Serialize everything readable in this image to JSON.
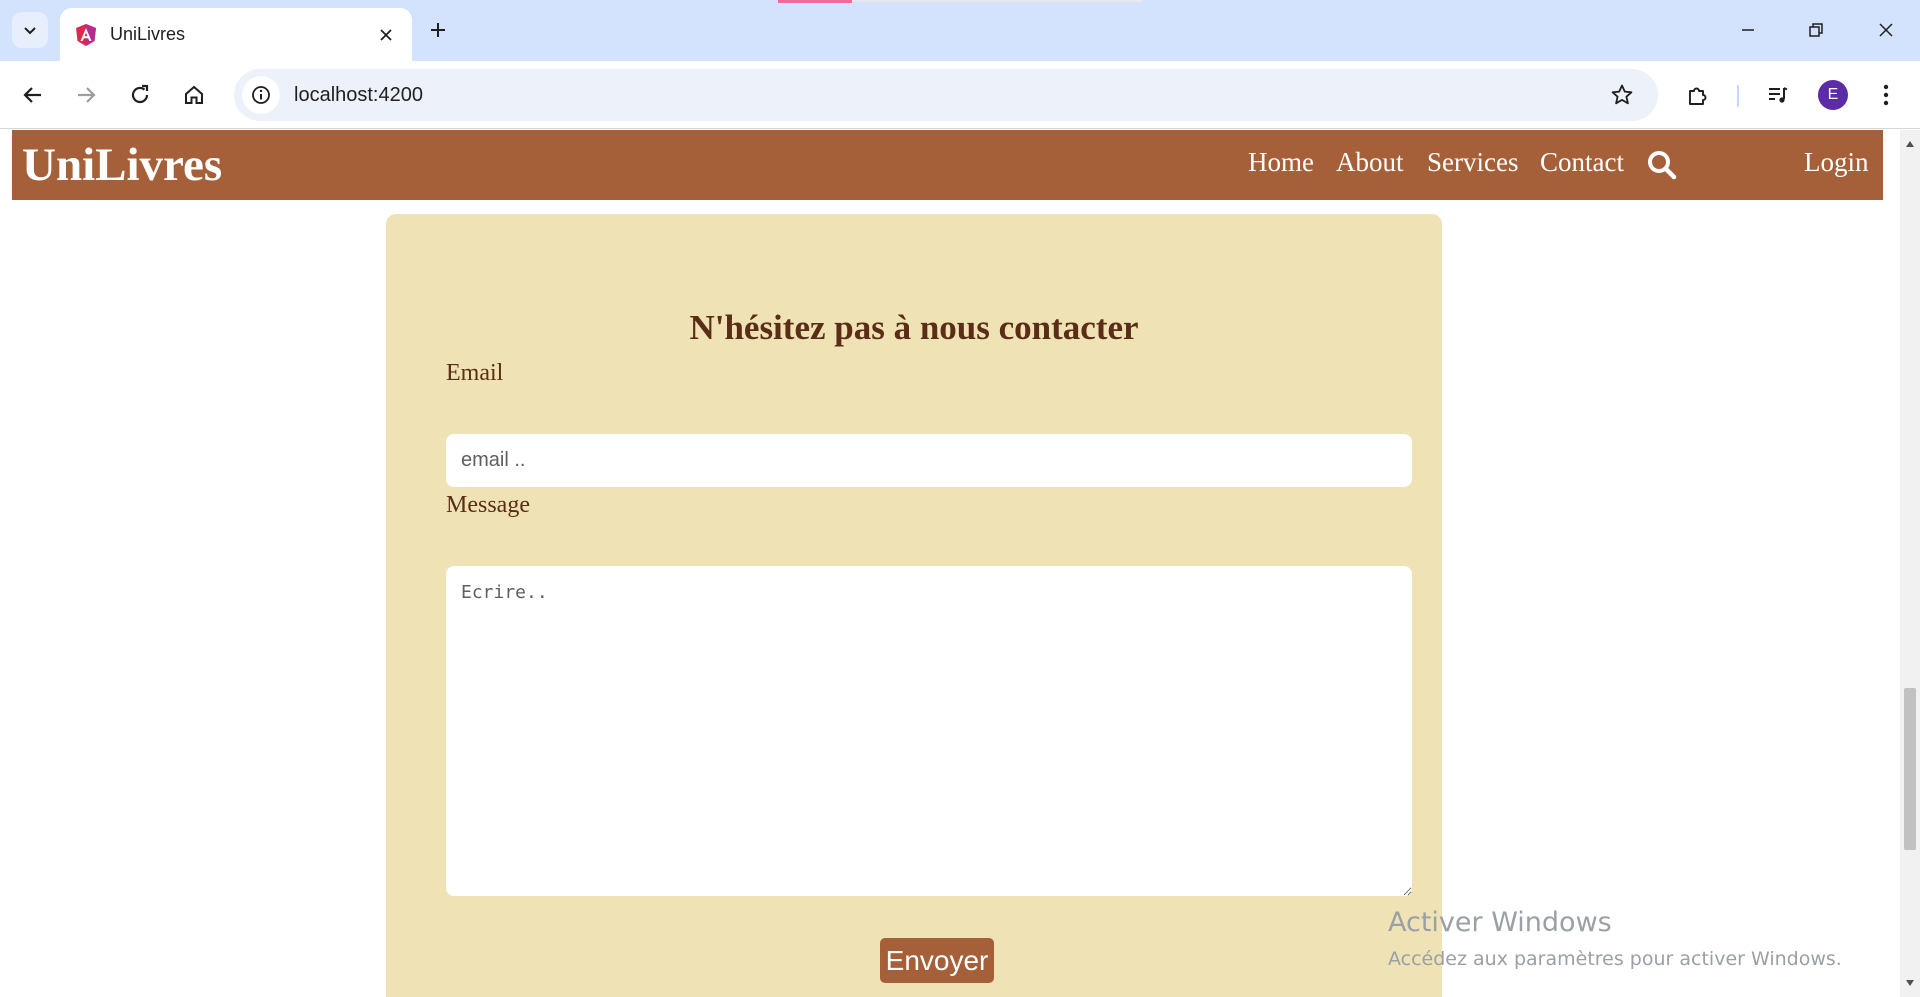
{
  "browser": {
    "tab_title": "UniLivres",
    "url": "localhost:4200",
    "profile_initial": "E",
    "icons": [
      "tab-list-icon",
      "angular-favicon",
      "close-icon",
      "plus-icon",
      "minimize-icon",
      "restore-icon",
      "close-window-icon",
      "back-icon",
      "forward-icon",
      "reload-icon",
      "home-icon",
      "site-info-icon",
      "star-icon",
      "extensions-icon",
      "media-control-icon",
      "more-icon"
    ]
  },
  "navbar": {
    "brand": "UniLivres",
    "links": [
      "Home",
      "About",
      "Services",
      "Contact"
    ],
    "login": "Login",
    "color": "#a5603a"
  },
  "form": {
    "title": "N'hésitez pas à nous contacter",
    "email_label": "Email",
    "email_placeholder": "email ..",
    "message_label": "Message",
    "message_placeholder": "Ecrire..",
    "submit": "Envoyer",
    "card_color": "#efe3b6",
    "text_color": "#5a2d16"
  },
  "watermark": {
    "title": "Activer Windows",
    "subtitle": "Accédez aux paramètres pour activer Windows."
  }
}
